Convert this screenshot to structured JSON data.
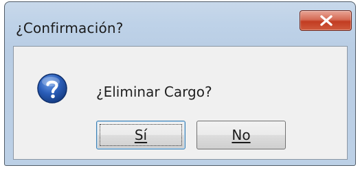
{
  "dialog": {
    "title": "¿Confirmación?",
    "close_icon": "close-icon",
    "message_icon": "question-icon",
    "message": "¿Eliminar Cargo?"
  },
  "buttons": {
    "yes_label": "Sí",
    "no_label": "No"
  },
  "colors": {
    "close_button": "#c9462b",
    "icon_blue": "#1f4f9e",
    "focused_button_border": "#3c7fb1"
  }
}
